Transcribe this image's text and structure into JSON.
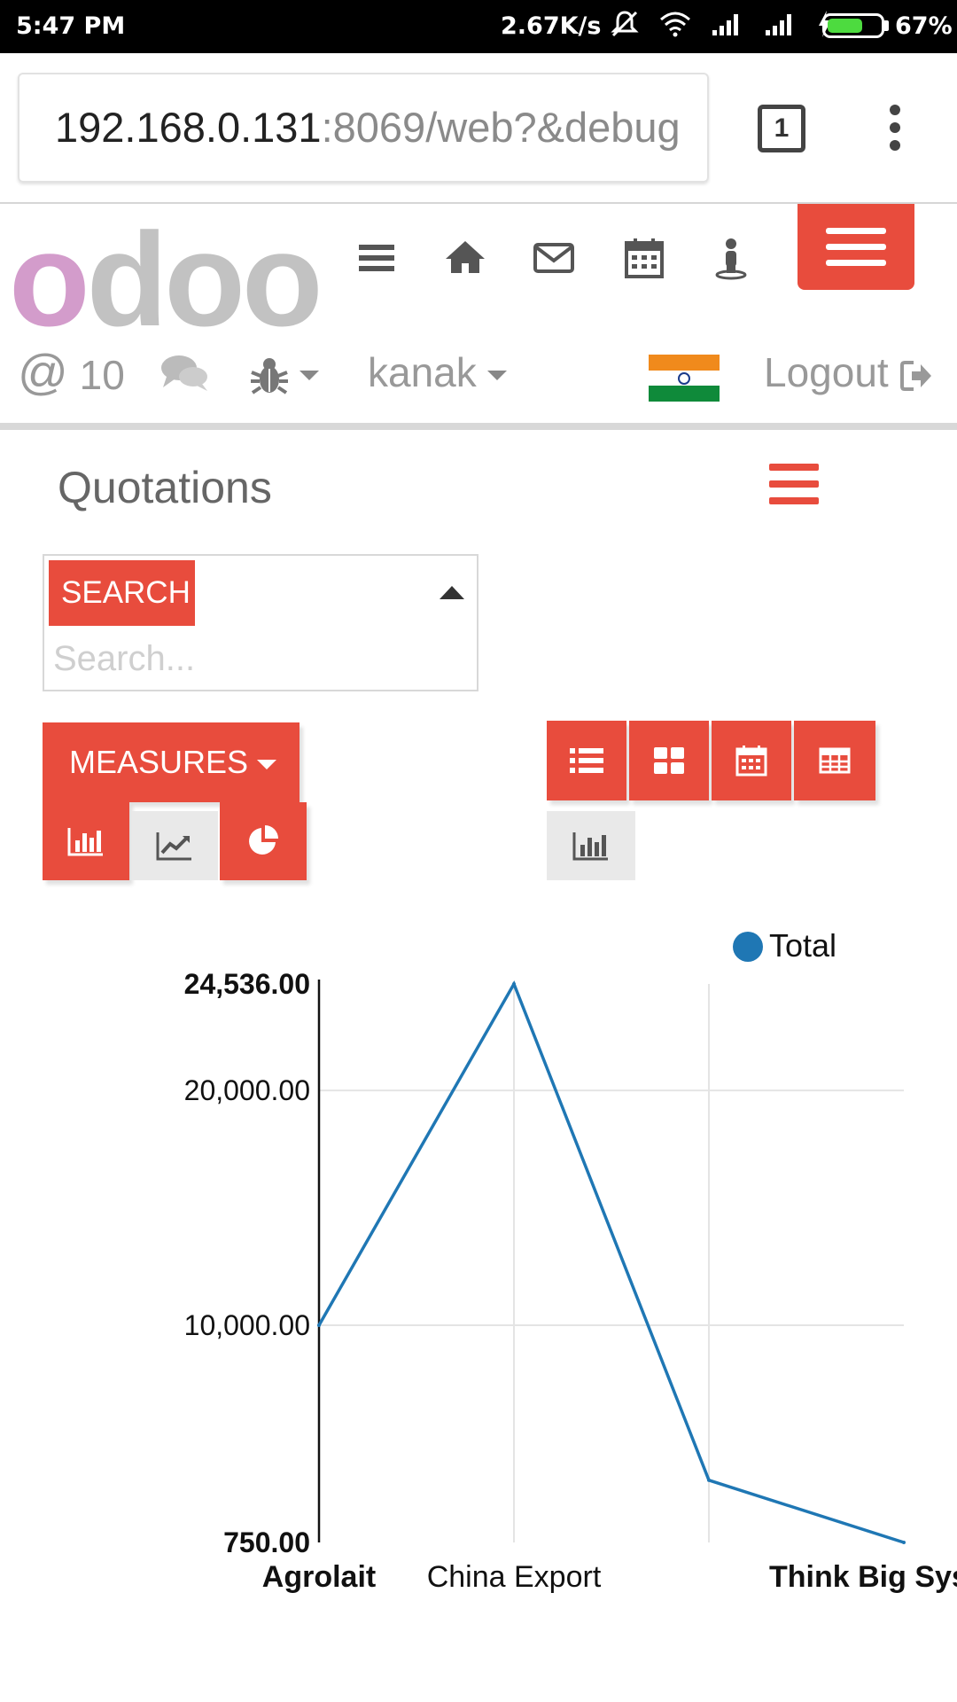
{
  "status_bar": {
    "time": "5:47 PM",
    "net_speed": "2.67K/s",
    "battery_level": 0.67,
    "battery_pct": "67%",
    "icons": [
      "mute-icon",
      "wifi-icon",
      "signal-icon",
      "signal-icon",
      "charging-icon"
    ]
  },
  "browser": {
    "url_host": "192.168.0.131",
    "url_rest": ":8069/web?&debug",
    "tab_count": "1"
  },
  "header": {
    "logo_first": "o",
    "logo_rest": "doo",
    "nav_icons": [
      "hamburger-icon",
      "home-icon",
      "mail-icon",
      "calendar-icon",
      "user-icon"
    ],
    "mentions_count": "10",
    "user_name": "kanak",
    "logout_label": "Logout",
    "flag_colors": [
      "#f08a1c",
      "#ffffff",
      "#0f8a3a"
    ],
    "accent_color": "#e84c3d"
  },
  "panel": {
    "title": "Quotations",
    "search_label": "SEARCH",
    "search_placeholder": "Search...",
    "measures_label": "MEASURES"
  },
  "chart_data": {
    "type": "line",
    "legend": [
      "Total"
    ],
    "legend_position": "top-right",
    "series": [
      {
        "name": "Total",
        "color": "#1f77b4",
        "values": [
          10000,
          24536,
          3400,
          750
        ]
      }
    ],
    "categories": [
      "Agrolait",
      "China Export",
      "",
      "Think Big Sys"
    ],
    "y_ticks": [
      "24,536.00",
      "20,000.00",
      "10,000.00",
      "750.00"
    ],
    "y_tick_values": [
      24536,
      20000,
      10000,
      750
    ],
    "ylim": [
      750,
      24536
    ],
    "grid": true
  }
}
